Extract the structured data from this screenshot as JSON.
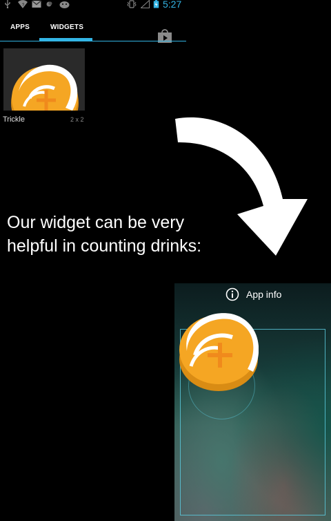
{
  "status_bar": {
    "time": "5:27",
    "icons": [
      "usb-icon",
      "wifi-icon",
      "gmail-icon",
      "color-icon",
      "android-icon",
      "vibrate-icon",
      "signal-icon",
      "battery-icon"
    ]
  },
  "widget_picker": {
    "tabs": [
      {
        "label": "APPS",
        "selected": false
      },
      {
        "label": "WIDGETS",
        "selected": true
      }
    ],
    "widget": {
      "name": "Trickle",
      "size": "2 x 2"
    }
  },
  "caption": {
    "line1": "Our widget can be very",
    "line2": "helpful in counting drinks:"
  },
  "home_screen": {
    "app_info_label": "App info"
  },
  "colors": {
    "accent": "#33b5e5",
    "coin_orange": "#f5a623",
    "coin_dark": "#d98c14"
  }
}
